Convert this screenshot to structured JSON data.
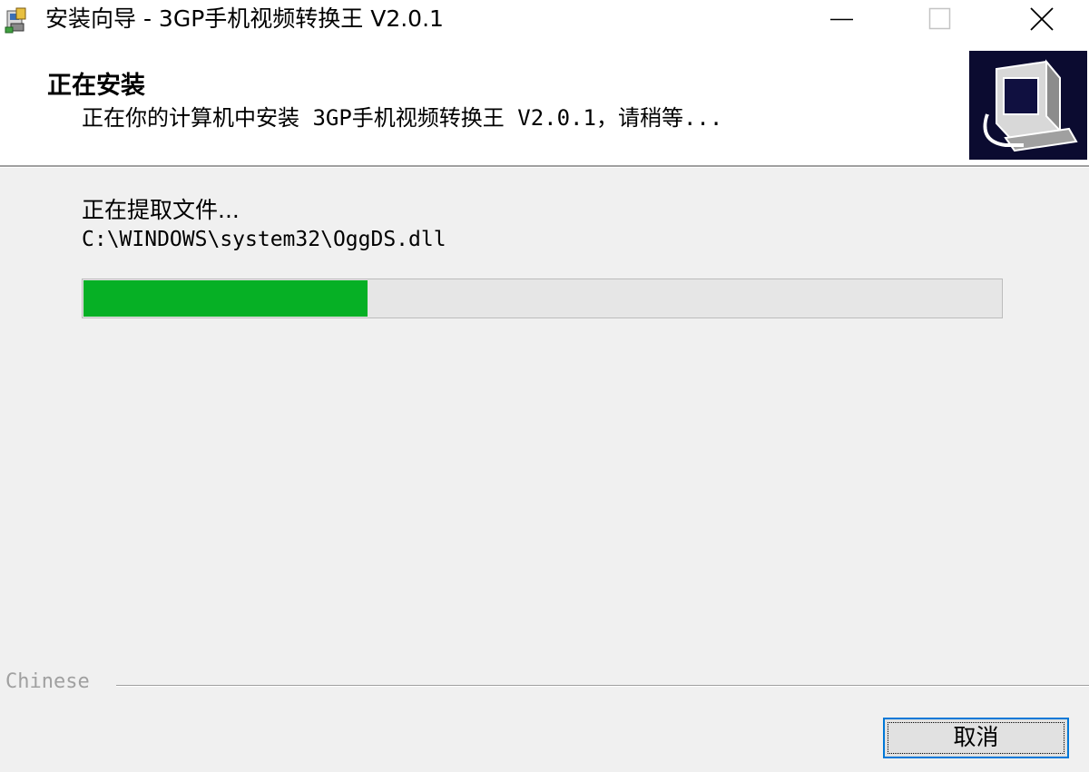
{
  "window": {
    "title": "安装向导 - 3GP手机视频转换王 V2.0.1"
  },
  "header": {
    "title": "正在安装",
    "subtitle": "正在你的计算机中安装 3GP手机视频转换王 V2.0.1，请稍等..."
  },
  "body": {
    "status": "正在提取文件...",
    "file_path": "C:\\WINDOWS\\system32\\OggDS.dll",
    "progress_fraction": 0.31,
    "progress_color": "#06b025"
  },
  "footer": {
    "language": "Chinese",
    "cancel_label": "取消"
  },
  "icons": [
    "installer-app-icon",
    "minimize-icon",
    "maximize-icon",
    "close-icon",
    "setup-computer-logo"
  ]
}
